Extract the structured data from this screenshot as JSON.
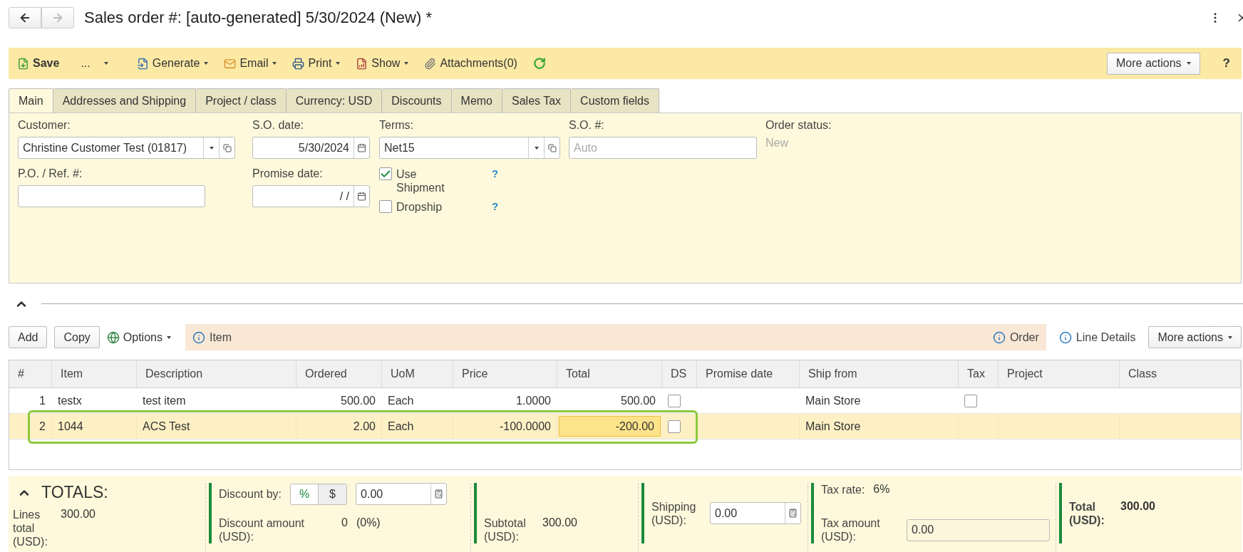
{
  "nav": [
    {
      "kind": "back",
      "disabled": false
    },
    {
      "kind": "forward",
      "disabled": true
    }
  ],
  "title": "Sales order #: [auto-generated] 5/30/2024 (New) *",
  "toolbar": {
    "items": [
      {
        "kind": "save",
        "label": "Save",
        "menu": false
      },
      {
        "kind": "more",
        "label": "...",
        "menu": true
      },
      {
        "kind": "generate",
        "label": "Generate",
        "menu": true
      },
      {
        "kind": "email",
        "label": "Email",
        "menu": true
      },
      {
        "kind": "print",
        "label": "Print",
        "menu": true
      },
      {
        "kind": "show",
        "label": "Show",
        "menu": true
      },
      {
        "kind": "attach",
        "label": "Attachments(0)",
        "menu": false
      },
      {
        "kind": "refresh",
        "menu": false
      }
    ],
    "more_actions": "More actions",
    "help": "?"
  },
  "tabs": [
    {
      "label": "Main",
      "selected": true
    },
    {
      "label": "Addresses and Shipping",
      "selected": false
    },
    {
      "label": "Project / class",
      "selected": false
    },
    {
      "label": "Currency: USD",
      "selected": false
    },
    {
      "label": "Discounts",
      "selected": false
    },
    {
      "label": "Memo",
      "selected": false
    },
    {
      "label": "Sales Tax",
      "selected": false
    },
    {
      "label": "Custom fields",
      "selected": false
    }
  ],
  "form": {
    "customer": {
      "label": "Customer:",
      "value": "Christine Customer Test (01817)"
    },
    "so_date": {
      "label": "S.O. date:",
      "value": "5/30/2024"
    },
    "terms": {
      "label": "Terms:",
      "value": "Net15"
    },
    "so_number": {
      "label": "S.O. #:",
      "placeholder": "Auto"
    },
    "order_status": {
      "label": "Order status:",
      "value": "New"
    },
    "po_ref": {
      "label": "P.O. / Ref. #:"
    },
    "promise_date": {
      "label": "Promise date:",
      "value": "/  /"
    },
    "checkboxes": [
      {
        "label": "Use Shipment",
        "checked": true,
        "help": "?"
      },
      {
        "label": "Dropship",
        "checked": false,
        "help": "?"
      }
    ]
  },
  "section_expanded": true,
  "grid_toolbar": {
    "buttons": [
      "Add",
      "Copy"
    ],
    "options": "Options",
    "info_left": "Item",
    "info_right": "Order",
    "line_details": "Line Details",
    "more_actions": "More actions"
  },
  "table": {
    "columns": [
      "#",
      "Item",
      "Description",
      "Ordered",
      "UoM",
      "Price",
      "Total",
      "DS",
      "Promise date",
      "Ship from",
      "Tax",
      "Project",
      "Class"
    ],
    "rows": [
      {
        "selected": false,
        "cells": [
          "1",
          "testx",
          "test item",
          "500.00",
          "Each",
          "1.0000",
          "500.00",
          "",
          "",
          "Main Store",
          "",
          "",
          ""
        ],
        "ds_checked": false,
        "tax": {
          "checked": false
        }
      },
      {
        "selected": true,
        "cells": [
          "2",
          "1044",
          "ACS Test",
          "2.00",
          "Each",
          "-100.0000",
          "-200.00",
          "",
          "",
          "Main Store",
          "",
          "",
          ""
        ],
        "ds_checked": false
      }
    ]
  },
  "totals": {
    "title": "TOTALS:",
    "expanded": true,
    "lines_total": {
      "label": "Lines total (USD):",
      "value": "300.00"
    },
    "discount_by": {
      "label": "Discount by:",
      "options": [
        {
          "label": "%",
          "selected": true
        },
        {
          "label": "$",
          "selected": false
        }
      ],
      "value": "0.00"
    },
    "discount_amount": {
      "label": "Discount amount (USD):",
      "value": "0",
      "percent": "(0%)"
    },
    "subtotal": {
      "label": "Subtotal (USD):",
      "value": "300.00"
    },
    "shipping": {
      "label": "Shipping (USD):",
      "value": "0.00"
    },
    "tax_rate": {
      "label": "Tax rate:",
      "value": "6%"
    },
    "tax_amount": {
      "label": "Tax amount (USD):",
      "value": "0.00"
    },
    "total": {
      "label": "Total (USD):",
      "value": "300.00"
    }
  }
}
